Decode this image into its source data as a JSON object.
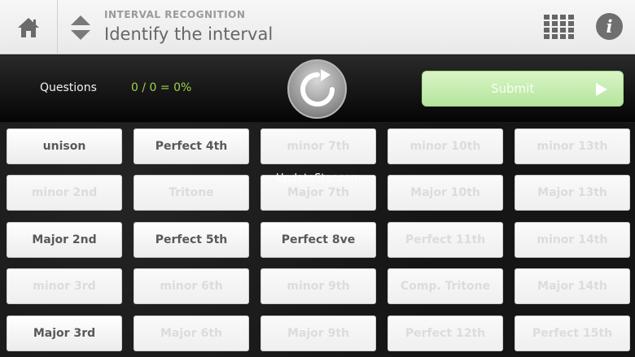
{
  "header": {
    "subtitle": "INTERVAL RECOGNITION",
    "title": "Identify the interval",
    "icons": [
      "home-icon",
      "up-down-arrows-icon",
      "grid-icon",
      "info-icon"
    ],
    "info_glyph": "i"
  },
  "control": {
    "questions_label": "Questions",
    "score": "0 / 0 = 0%",
    "submit_label": "Submit"
  },
  "answers": [
    {
      "label": "unison",
      "enabled": true
    },
    {
      "label": "Perfect 4th",
      "enabled": true
    },
    {
      "label": "minor 7th",
      "enabled": false
    },
    {
      "label": "minor 10th",
      "enabled": false
    },
    {
      "label": "minor 13th",
      "enabled": false
    },
    {
      "label": "minor 2nd",
      "enabled": false
    },
    {
      "label": "Tritone",
      "enabled": false
    },
    {
      "label": "Major 7th",
      "enabled": false
    },
    {
      "label": "Major 10th",
      "enabled": false
    },
    {
      "label": "Major 13th",
      "enabled": false
    },
    {
      "label": "Major 2nd",
      "enabled": true
    },
    {
      "label": "Perfect 5th",
      "enabled": true
    },
    {
      "label": "Perfect 8ve",
      "enabled": true
    },
    {
      "label": "Perfect 11th",
      "enabled": false
    },
    {
      "label": "minor 14th",
      "enabled": false
    },
    {
      "label": "minor 3rd",
      "enabled": false
    },
    {
      "label": "minor 6th",
      "enabled": false
    },
    {
      "label": "minor 9th",
      "enabled": false
    },
    {
      "label": "Comp. Tritone",
      "enabled": false
    },
    {
      "label": "Major 14th",
      "enabled": false
    },
    {
      "label": "Major 3rd",
      "enabled": true
    },
    {
      "label": "Major 6th",
      "enabled": false
    },
    {
      "label": "Major 9th",
      "enabled": false
    },
    {
      "label": "Perfect 12th",
      "enabled": false
    },
    {
      "label": "Perfect 15th",
      "enabled": false
    }
  ],
  "watermark": "UpdateStar.com",
  "colors": {
    "score_green": "#9fd34b",
    "submit_green": "#b6e49d"
  }
}
